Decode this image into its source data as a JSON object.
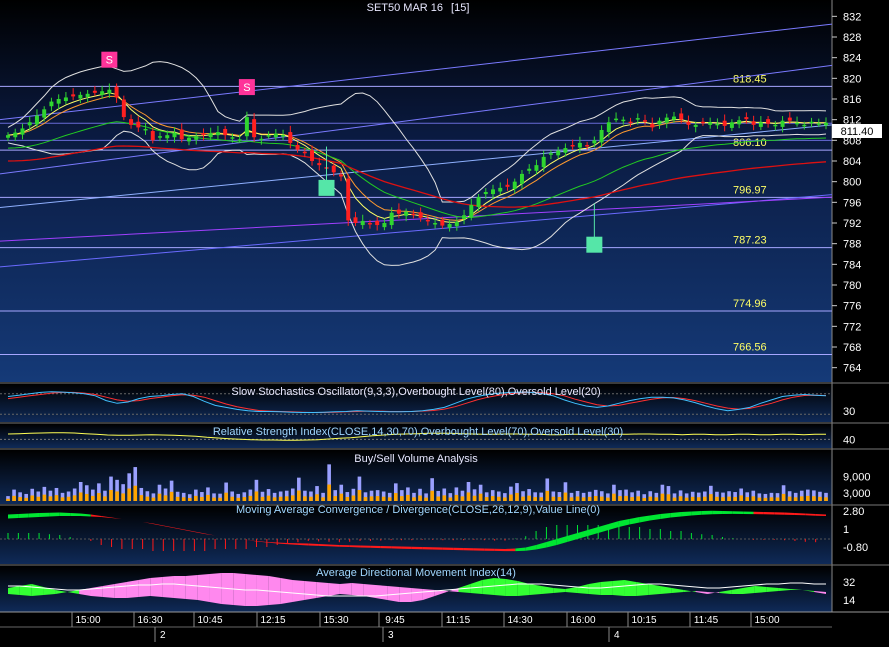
{
  "window": {
    "title": "SET50 MAR 16",
    "interval": "[15]"
  },
  "last_price": "811.40",
  "colors": {
    "panel_bg_top": "#000000",
    "panel_bg_bottom": "#10306a",
    "up": "#2fd52f",
    "down": "#ff2020",
    "fib": "#a6a6ff",
    "bb": "#e0e0e0",
    "signal": "#ff3399",
    "marker": "#55e6a8",
    "macd_up": "#00e632",
    "macd_down": "#ff1a1a",
    "adx_pos": "#33ff33",
    "adx_neg": "#ff88ee"
  },
  "panels": {
    "price": {
      "y_ticks": [
        "832",
        "828",
        "824",
        "820",
        "816",
        "812",
        "808",
        "804",
        "800",
        "796",
        "792",
        "788",
        "784",
        "780",
        "776",
        "772",
        "768",
        "764"
      ]
    },
    "stoch": {
      "title": "Slow Stochastics Oscillator(9,3,3),Overbought Level(80),Oversold Level(20)",
      "y_ticks": [
        "30"
      ]
    },
    "rsi": {
      "title": "Relative Strength Index(CLOSE,14,30,70),Overbought Level(70),Oversold Level(30)",
      "y_ticks": [
        "40"
      ]
    },
    "volume": {
      "title": "Buy/Sell Volume Analysis",
      "y_ticks": [
        "9,000",
        "3,000"
      ]
    },
    "macd": {
      "title": "Moving Average Convergence / Divergence(CLOSE,26,12,9),Value Line(0)",
      "y_ticks": [
        "2.80",
        "1",
        "-0.80"
      ]
    },
    "adx": {
      "title": "Average Directional Movement Index(14)",
      "y_ticks": [
        "32",
        "14"
      ]
    }
  },
  "time_axis": {
    "labels": [
      "15:00",
      "16:30",
      "10:45",
      "12:15",
      "15:30",
      "9:45",
      "11:15",
      "14:30",
      "16:00",
      "10:15",
      "11:45",
      "15:00"
    ],
    "days": [
      "2",
      "3",
      "4"
    ]
  },
  "chart_data": {
    "type": "candlestick",
    "title": "SET50 MAR 16 [15]",
    "ylim": [
      762,
      834
    ],
    "fib_levels": [
      818.45,
      806.1,
      796.97,
      787.23,
      774.96,
      766.56
    ],
    "signals": [
      {
        "label": "S",
        "index": 14
      },
      {
        "label": "S",
        "index": 33
      }
    ],
    "close": [
      809.0,
      809.5,
      810.3,
      811.5,
      812.8,
      814.0,
      815.5,
      816.0,
      816.3,
      816.5,
      816.8,
      817.0,
      817.2,
      817.5,
      817.8,
      816.3,
      812.5,
      811.0,
      810.5,
      810.2,
      808.0,
      808.8,
      809.0,
      809.5,
      808.2,
      808.5,
      808.8,
      809.0,
      809.4,
      809.6,
      809.0,
      808.6,
      808.2,
      812.5,
      808.6,
      808.3,
      809.0,
      809.3,
      809.0,
      807.5,
      806.2,
      805.5,
      804.0,
      803.2,
      802.5,
      801.8,
      801.0,
      792.5,
      792.0,
      792.4,
      791.8,
      791.6,
      792.0,
      794.0,
      793.8,
      794.2,
      793.5,
      793.0,
      792.4,
      792.0,
      791.5,
      791.8,
      792.2,
      793.5,
      795.5,
      797.0,
      798.0,
      798.5,
      798.8,
      799.0,
      800.0,
      801.5,
      802.5,
      803.2,
      804.8,
      805.5,
      806.0,
      806.5,
      807.0,
      807.5,
      806.8,
      808.0,
      810.0,
      811.5,
      812.2,
      812.0,
      811.5,
      812.3,
      811.6,
      810.5,
      811.8,
      812.4,
      812.6,
      812.0,
      811.0,
      811.0,
      811.4,
      811.5,
      811.2,
      810.8,
      811.5,
      811.9,
      812.1,
      811.0,
      811.5,
      811.2,
      811.0,
      811.8,
      811.8,
      811.4,
      811.0,
      811.6,
      811.3,
      811.4
    ]
  },
  "stoch_k": [
    72,
    76,
    80,
    84,
    86,
    85,
    83,
    80,
    74,
    60,
    52,
    56,
    66,
    72,
    74,
    78,
    80,
    72,
    58,
    46,
    40,
    34,
    30,
    28,
    28,
    27,
    26,
    25,
    25,
    26,
    27,
    28,
    30,
    29,
    28,
    27,
    27,
    28,
    30,
    34,
    40,
    52,
    64,
    72,
    78,
    82,
    84,
    85,
    84,
    80,
    74,
    62,
    52,
    44,
    40,
    44,
    52,
    60,
    66,
    70,
    70,
    68,
    62,
    54,
    44,
    36,
    30,
    34,
    40,
    52,
    62,
    72,
    76,
    78,
    76,
    74
  ],
  "stoch_d": [
    66,
    70,
    74,
    78,
    82,
    84,
    84,
    82,
    78,
    70,
    62,
    58,
    60,
    66,
    70,
    74,
    77,
    76,
    70,
    60,
    50,
    42,
    36,
    31,
    29,
    28,
    27,
    26,
    25,
    25,
    26,
    27,
    28,
    29,
    29,
    28,
    28,
    28,
    29,
    31,
    35,
    42,
    52,
    62,
    70,
    76,
    80,
    83,
    84,
    83,
    80,
    74,
    64,
    56,
    48,
    44,
    46,
    52,
    58,
    64,
    68,
    69,
    66,
    60,
    52,
    44,
    38,
    35,
    37,
    44,
    52,
    62,
    70,
    75,
    76,
    75
  ],
  "rsi": [
    56,
    57,
    58,
    59,
    60,
    60,
    59,
    57,
    55,
    53,
    52,
    52,
    53,
    54,
    53,
    52,
    51,
    49,
    46,
    44,
    42,
    40,
    39,
    38,
    38,
    37,
    37,
    38,
    39,
    41,
    43,
    45,
    48,
    51,
    53,
    55,
    56,
    57,
    58,
    58,
    58,
    57,
    56,
    55,
    55,
    56,
    56,
    55,
    55,
    54,
    54,
    55,
    55,
    54,
    54,
    55,
    55,
    56,
    56,
    55,
    55,
    54,
    55,
    55,
    54,
    54,
    55,
    55,
    54,
    54,
    55,
    55,
    54,
    55,
    55
  ],
  "volume": [
    1800,
    4200,
    3200,
    2600,
    4500,
    3500,
    5200,
    3800,
    4800,
    3000,
    3500,
    4600,
    7000,
    5800,
    4200,
    6500,
    3800,
    9000,
    7800,
    6200,
    10200,
    12500,
    4800,
    3600,
    2800,
    6000,
    4600,
    7500,
    3400,
    3000,
    2500,
    4200,
    3300,
    5000,
    2800,
    2700,
    6800,
    3500,
    2600,
    3200,
    4200,
    7800,
    3400,
    4400,
    3000,
    3500,
    3800,
    4600,
    8600,
    3800,
    3500,
    5500,
    3000,
    13500,
    4000,
    6000,
    3300,
    4500,
    9000,
    3200,
    3800,
    4000,
    3500,
    3000,
    6500,
    4000,
    5000,
    3000,
    4500,
    2800,
    8400,
    3700,
    4600,
    2900,
    5000,
    3800,
    7000,
    4300,
    6000,
    3200,
    4000,
    3500,
    2900,
    5300,
    6600,
    3600,
    4400,
    3200,
    3100,
    8300,
    3500,
    3300,
    6900,
    3000,
    3700,
    3000,
    3400,
    4100,
    3600,
    2800,
    6000,
    4000,
    4200,
    3200,
    3800,
    2500,
    3600,
    3000,
    6000,
    5500,
    2800,
    3900,
    2800,
    3400,
    3100,
    3500,
    5600,
    3400,
    3100,
    3600,
    3300,
    4600,
    3200,
    3800,
    2800,
    2600,
    3000,
    2900,
    5800,
    3600,
    3000,
    3800,
    4200,
    3900,
    3400,
    3000
  ],
  "macd": [
    2.45,
    2.5,
    2.55,
    2.6,
    2.62,
    2.65,
    2.6,
    2.55,
    2.45,
    2.3,
    2.15,
    2.0,
    1.85,
    1.7,
    1.5,
    1.3,
    1.1,
    0.9,
    0.7,
    0.5,
    0.35,
    0.2,
    0.05,
    -0.1,
    -0.2,
    -0.3,
    -0.35,
    -0.4,
    -0.42,
    -0.45,
    -0.5,
    -0.55,
    -0.6,
    -0.62,
    -0.65,
    -0.68,
    -0.7,
    -0.72,
    -0.75,
    -0.78,
    -0.8,
    -0.82,
    -0.85,
    -0.88,
    -0.9,
    -0.92,
    -0.95,
    -0.98,
    -1.0,
    -0.95,
    -0.85,
    -0.6,
    -0.3,
    0.0,
    0.3,
    0.6,
    0.9,
    1.2,
    1.5,
    1.8,
    2.0,
    2.2,
    2.35,
    2.5,
    2.6,
    2.7,
    2.75,
    2.8,
    2.82,
    2.8,
    2.78,
    2.75,
    2.72,
    2.7,
    2.68,
    2.65,
    2.6,
    2.55,
    2.5,
    2.45
  ],
  "macd_signal": [
    2.3,
    2.35,
    2.4,
    2.45,
    2.5,
    2.55,
    2.55,
    2.55,
    2.5,
    2.45,
    2.35,
    2.25,
    2.1,
    1.95,
    1.8,
    1.6,
    1.4,
    1.2,
    1.0,
    0.8,
    0.6,
    0.45,
    0.3,
    0.15,
    0.0,
    -0.1,
    -0.2,
    -0.28,
    -0.34,
    -0.4,
    -0.44,
    -0.48,
    -0.52,
    -0.55,
    -0.6,
    -0.63,
    -0.66,
    -0.69,
    -0.72,
    -0.75,
    -0.78,
    -0.8,
    -0.82,
    -0.85,
    -0.87,
    -0.9,
    -0.92,
    -0.94,
    -0.96,
    -0.96,
    -0.92,
    -0.8,
    -0.6,
    -0.35,
    -0.05,
    0.25,
    0.55,
    0.85,
    1.15,
    1.45,
    1.7,
    1.9,
    2.1,
    2.25,
    2.4,
    2.5,
    2.6,
    2.68,
    2.72,
    2.75,
    2.76,
    2.75,
    2.74,
    2.72,
    2.7,
    2.68,
    2.65,
    2.62,
    2.58,
    2.55
  ],
  "adx_di_plus": [
    26,
    28,
    30,
    27,
    24,
    22,
    20,
    18,
    17,
    16,
    16,
    17,
    18,
    17,
    16,
    15,
    14,
    12,
    10,
    9,
    8,
    8,
    9,
    10,
    12,
    14,
    16,
    18,
    20,
    19,
    18,
    16,
    14,
    12,
    12,
    14,
    18,
    22,
    26,
    30,
    34,
    36,
    35,
    33,
    30,
    28,
    26,
    25,
    27,
    30,
    32,
    33,
    34,
    32,
    30,
    28,
    26,
    24,
    22,
    20,
    22,
    24,
    26,
    28,
    27,
    26,
    25,
    24,
    22,
    20
  ],
  "adx_di_minus": [
    20,
    19,
    18,
    19,
    20,
    22,
    24,
    26,
    28,
    30,
    32,
    34,
    36,
    37,
    38,
    38,
    39,
    40,
    41,
    41,
    40,
    39,
    38,
    36,
    34,
    33,
    32,
    31,
    30,
    31,
    30,
    29,
    28,
    27,
    26,
    25,
    24,
    23,
    22,
    21,
    20,
    19,
    18,
    18,
    19,
    20,
    21,
    22,
    21,
    20,
    19,
    19,
    18,
    18,
    19,
    20,
    21,
    22,
    23,
    22,
    21,
    20,
    20,
    21,
    22,
    23,
    24,
    24,
    23,
    22
  ],
  "adx_line": [
    28,
    28,
    27,
    26,
    25,
    24,
    24,
    25,
    26,
    27,
    28,
    29,
    29,
    30,
    30,
    29,
    28,
    27,
    26,
    25,
    24,
    24,
    23,
    22,
    21,
    20,
    19,
    18,
    18,
    18,
    18,
    18,
    19,
    20,
    21,
    22,
    23,
    24,
    25,
    26,
    27,
    28,
    29,
    30,
    30,
    30,
    29,
    28,
    27,
    26,
    26,
    27,
    28,
    29,
    30,
    30,
    29,
    28,
    27,
    26,
    26,
    27,
    28,
    29,
    30,
    30,
    31,
    31,
    30,
    30
  ]
}
